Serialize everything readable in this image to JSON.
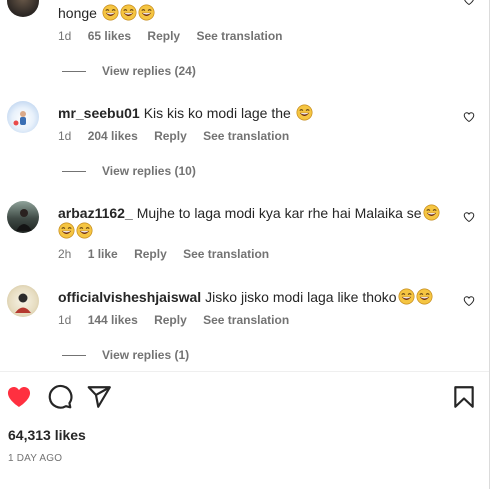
{
  "comments": [
    {
      "text": "honge",
      "emojis": 3,
      "time": "1d",
      "likes": "65 likes",
      "reply": "Reply",
      "translate": "See translation",
      "view_replies": "View replies (24)"
    },
    {
      "username": "mr_seebu01",
      "text": "Kis kis ko modi lage the",
      "emojis": 1,
      "time": "1d",
      "likes": "204 likes",
      "reply": "Reply",
      "translate": "See translation",
      "view_replies": "View replies (10)"
    },
    {
      "username": "arbaz1162_",
      "text": "Mujhe to laga modi kya kar rhe hai Malaika se",
      "emojis": 3,
      "time": "2h",
      "likes": "1 like",
      "reply": "Reply",
      "translate": "See translation"
    },
    {
      "username": "officialvisheshjaiswal",
      "text": "Jisko jisko modi laga like thoko",
      "emojis": 2,
      "time": "1d",
      "likes": "144 likes",
      "reply": "Reply",
      "translate": "See translation",
      "view_replies": "View replies (1)"
    }
  ],
  "post": {
    "likes": "64,313 likes",
    "date": "1 DAY AGO",
    "liked": true
  },
  "icons": {
    "like": "heart-filled-icon",
    "comment": "comment-bubble-icon",
    "share": "paper-plane-icon",
    "save": "bookmark-icon",
    "comment_like": "heart-outline-icon",
    "emoji": "laughing-face-emoji"
  },
  "colors": {
    "like_red": "#ff3040",
    "secondary_text": "#737373",
    "primary_text": "#262626"
  }
}
